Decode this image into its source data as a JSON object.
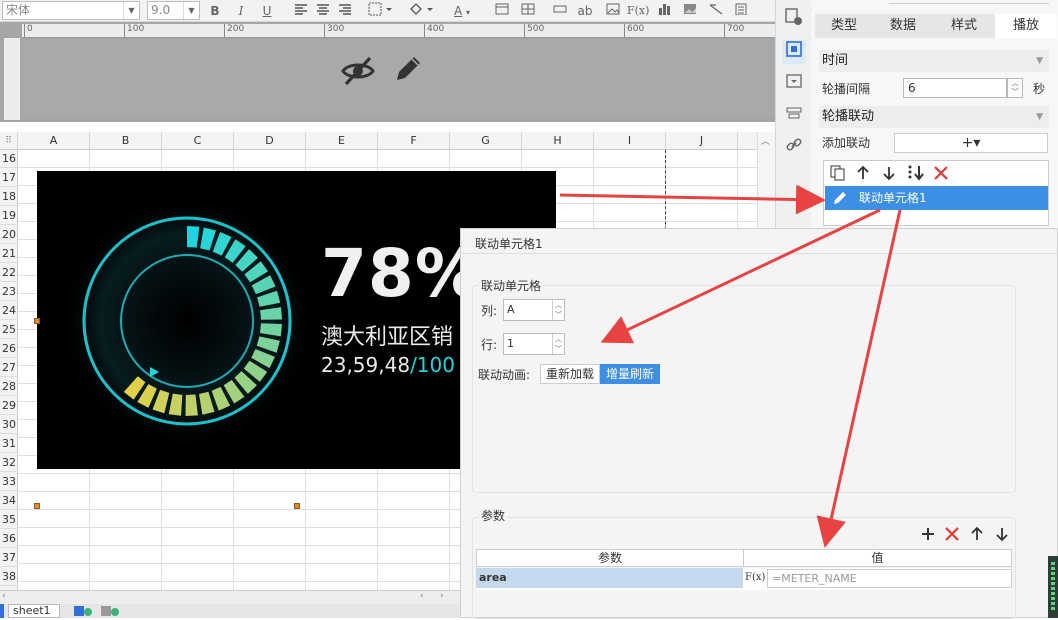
{
  "toolbar": {
    "font_name": "宋体",
    "font_size": "9.0",
    "bold": "B",
    "italic": "I",
    "underline": "U",
    "text_label": "ab",
    "formula": "F(x)",
    "font_color": "A"
  },
  "ruler": {
    "ticks": [
      "0",
      "100",
      "200",
      "300",
      "400",
      "500",
      "600",
      "700"
    ]
  },
  "grid": {
    "columns": [
      "A",
      "B",
      "C",
      "D",
      "E",
      "F",
      "G",
      "H",
      "I",
      "J"
    ],
    "rows": [
      "16",
      "17",
      "18",
      "19",
      "20",
      "21",
      "22",
      "23",
      "24",
      "25",
      "26",
      "27",
      "28",
      "29",
      "30",
      "31",
      "32",
      "33",
      "34",
      "35",
      "36",
      "37",
      "38"
    ]
  },
  "widget": {
    "percent": "78%",
    "region_label": "澳大利亚区销",
    "figures_main": "23,59,48",
    "figures_slash": "/100"
  },
  "sheet_tabs": [
    "sheet1"
  ],
  "right_panel": {
    "tabs": [
      "类型",
      "数据",
      "样式",
      "播放"
    ],
    "active_tab": "播放",
    "section_time": "时间",
    "carousel_interval_label": "轮播间隔",
    "carousel_interval_value": "6",
    "seconds_unit": "秒",
    "section_link": "轮播联动",
    "add_link_label": "添加联动",
    "add_link_button": "+▾",
    "link_item": "联动单元格1"
  },
  "dialog": {
    "title": "联动单元格1",
    "group_title": "联动单元格",
    "column_label": "列:",
    "column_value": "A",
    "row_label": "行:",
    "row_value": "1",
    "animation_label": "联动动画:",
    "reload_option": "重新加载",
    "incremental_option": "增量刷新",
    "params_title": "参数",
    "table_headers": [
      "参数",
      "值"
    ],
    "param_name": "area",
    "param_formula_icon": "F(x)",
    "param_value": "=METER_NAME"
  },
  "colors": {
    "accent_blue": "#3d8fe6",
    "arrow_red": "#e84343",
    "gauge_cyan": "#1fd6e0",
    "gauge_yellow": "#e3d04a"
  }
}
